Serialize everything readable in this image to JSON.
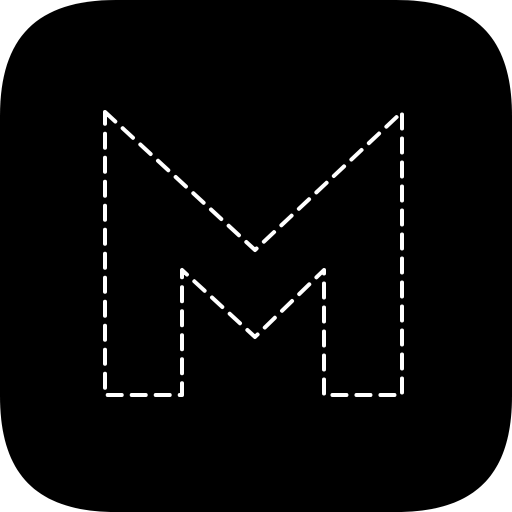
{
  "icon": {
    "name": "dashed-m-logo",
    "background_color": "#000000",
    "stroke_color": "#ffffff",
    "stroke_style": "dashed",
    "glyph": "M"
  }
}
